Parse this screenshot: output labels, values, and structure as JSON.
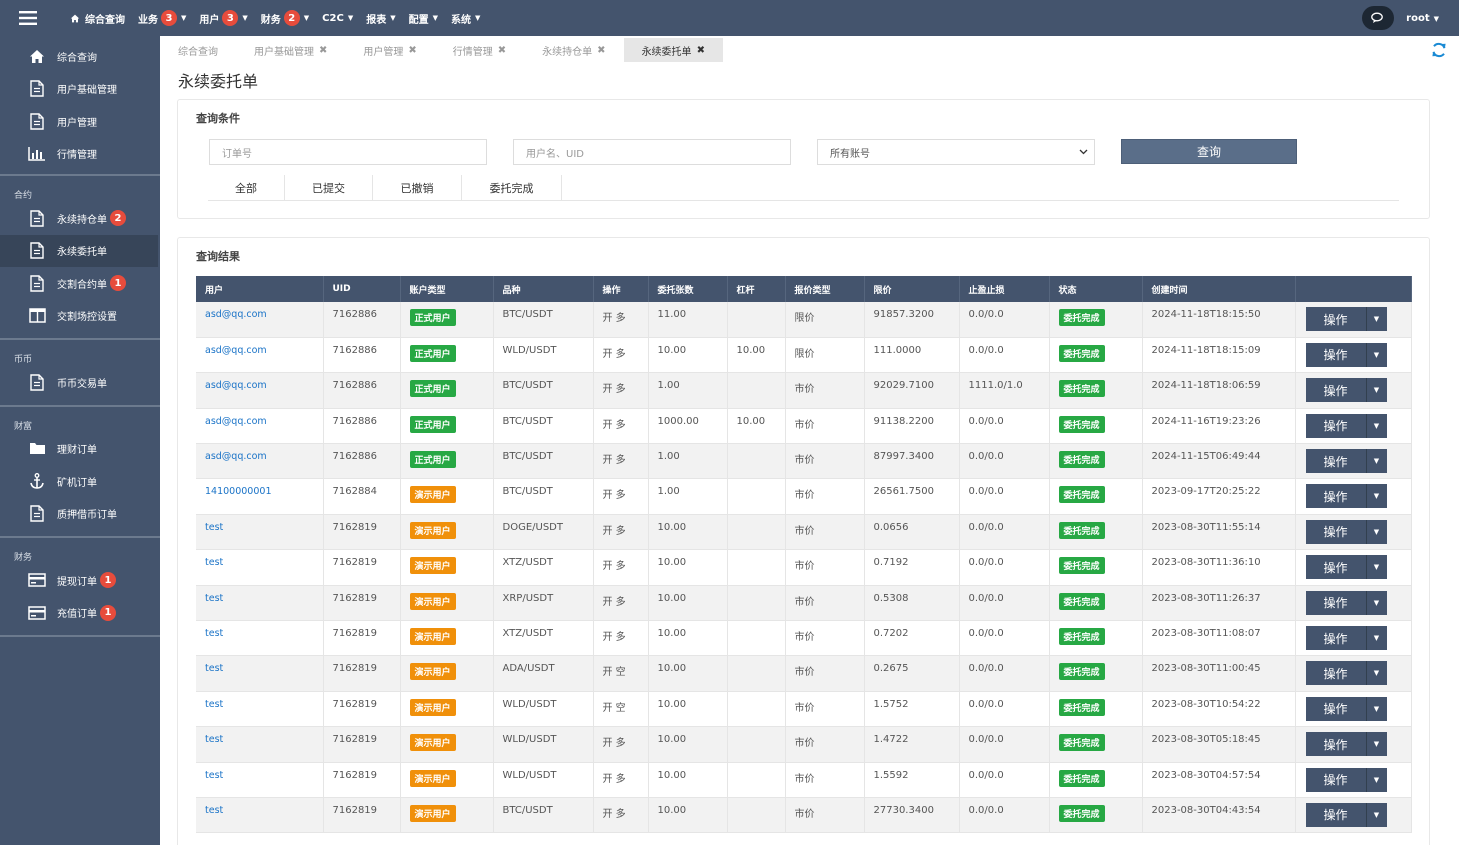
{
  "topbar": {
    "nav": [
      {
        "label": "综合查询",
        "icon": "home-icon",
        "badge": null,
        "caret": false
      },
      {
        "label": "业务",
        "badge": "3",
        "caret": true
      },
      {
        "label": "用户",
        "badge": "3",
        "caret": true
      },
      {
        "label": "财务",
        "badge": "2",
        "caret": true
      },
      {
        "label": "C2C",
        "badge": null,
        "caret": true
      },
      {
        "label": "报表",
        "badge": null,
        "caret": true
      },
      {
        "label": "配置",
        "badge": null,
        "caret": true
      },
      {
        "label": "系统",
        "badge": null,
        "caret": true
      }
    ],
    "user": "root"
  },
  "sidebar": {
    "top_items": [
      {
        "label": "综合查询",
        "icon": "home-icon"
      },
      {
        "label": "用户基础管理",
        "icon": "file-icon"
      },
      {
        "label": "用户管理",
        "icon": "file-icon"
      },
      {
        "label": "行情管理",
        "icon": "bar-chart-icon"
      }
    ],
    "contract": {
      "label": "合约",
      "items": [
        {
          "label": "永续持仓单",
          "icon": "file-icon",
          "badge": "2"
        },
        {
          "label": "永续委托单",
          "icon": "file-icon",
          "badge": null,
          "active": true
        },
        {
          "label": "交割合约单",
          "icon": "file-icon",
          "badge": "1"
        },
        {
          "label": "交割场控设置",
          "icon": "columns-icon",
          "badge": null
        }
      ]
    },
    "coin": {
      "label": "币币",
      "items": [
        {
          "label": "币币交易单",
          "icon": "file-icon",
          "badge": null
        }
      ]
    },
    "wealth": {
      "label": "财富",
      "items": [
        {
          "label": "理财订单",
          "icon": "folder-icon",
          "badge": null
        },
        {
          "label": "矿机订单",
          "icon": "anchor-icon",
          "badge": null
        },
        {
          "label": "质押借币订单",
          "icon": "file-icon",
          "badge": null
        }
      ]
    },
    "finance": {
      "label": "财务",
      "items": [
        {
          "label": "提现订单",
          "icon": "card-icon",
          "badge": "1"
        },
        {
          "label": "充值订单",
          "icon": "card-icon",
          "badge": "1"
        }
      ]
    }
  },
  "tabs": [
    {
      "label": "综合查询",
      "closable": false
    },
    {
      "label": "用户基础管理",
      "closable": true
    },
    {
      "label": "用户管理",
      "closable": true
    },
    {
      "label": "行情管理",
      "closable": true
    },
    {
      "label": "永续持仓单",
      "closable": true
    },
    {
      "label": "永续委托单",
      "closable": true,
      "active": true
    }
  ],
  "page_title": "永续委托单",
  "query": {
    "title": "查询条件",
    "order_placeholder": "订单号",
    "user_placeholder": "用户名、UID",
    "account_select": "所有账号",
    "query_button": "查询",
    "filters": [
      "全部",
      "已提交",
      "已撤销",
      "委托完成"
    ]
  },
  "results": {
    "title": "查询结果",
    "columns": [
      "用户",
      "UID",
      "账户类型",
      "品种",
      "操作",
      "委托张数",
      "杠杆",
      "报价类型",
      "限价",
      "止盈止损",
      "状态",
      "创建时间",
      ""
    ],
    "op_label": "操作",
    "rows": [
      {
        "user": "asd@qq.com",
        "uid": "7162886",
        "type": "正式用户",
        "real": true,
        "symbol": "BTC/USDT",
        "dir": "开 多",
        "qty": "11.00",
        "lev": "",
        "ptype": "限价",
        "price": "91857.3200",
        "tpsl": "0.0/0.0",
        "status": "委托完成",
        "time": "2024-11-18T18:15:50"
      },
      {
        "user": "asd@qq.com",
        "uid": "7162886",
        "type": "正式用户",
        "real": true,
        "symbol": "WLD/USDT",
        "dir": "开 多",
        "qty": "10.00",
        "lev": "10.00",
        "ptype": "限价",
        "price": "111.0000",
        "tpsl": "0.0/0.0",
        "status": "委托完成",
        "time": "2024-11-18T18:15:09"
      },
      {
        "user": "asd@qq.com",
        "uid": "7162886",
        "type": "正式用户",
        "real": true,
        "symbol": "BTC/USDT",
        "dir": "开 多",
        "qty": "1.00",
        "lev": "",
        "ptype": "市价",
        "price": "92029.7100",
        "tpsl": "1111.0/1.0",
        "status": "委托完成",
        "time": "2024-11-18T18:06:59"
      },
      {
        "user": "asd@qq.com",
        "uid": "7162886",
        "type": "正式用户",
        "real": true,
        "symbol": "BTC/USDT",
        "dir": "开 多",
        "qty": "1000.00",
        "lev": "10.00",
        "ptype": "市价",
        "price": "91138.2200",
        "tpsl": "0.0/0.0",
        "status": "委托完成",
        "time": "2024-11-16T19:23:26"
      },
      {
        "user": "asd@qq.com",
        "uid": "7162886",
        "type": "正式用户",
        "real": true,
        "symbol": "BTC/USDT",
        "dir": "开 多",
        "qty": "1.00",
        "lev": "",
        "ptype": "市价",
        "price": "87997.3400",
        "tpsl": "0.0/0.0",
        "status": "委托完成",
        "time": "2024-11-15T06:49:44"
      },
      {
        "user": "14100000001",
        "uid": "7162884",
        "type": "演示用户",
        "real": false,
        "symbol": "BTC/USDT",
        "dir": "开 多",
        "qty": "1.00",
        "lev": "",
        "ptype": "市价",
        "price": "26561.7500",
        "tpsl": "0.0/0.0",
        "status": "委托完成",
        "time": "2023-09-17T20:25:22"
      },
      {
        "user": "test",
        "uid": "7162819",
        "type": "演示用户",
        "real": false,
        "symbol": "DOGE/USDT",
        "dir": "开 多",
        "qty": "10.00",
        "lev": "",
        "ptype": "市价",
        "price": "0.0656",
        "tpsl": "0.0/0.0",
        "status": "委托完成",
        "time": "2023-08-30T11:55:14"
      },
      {
        "user": "test",
        "uid": "7162819",
        "type": "演示用户",
        "real": false,
        "symbol": "XTZ/USDT",
        "dir": "开 多",
        "qty": "10.00",
        "lev": "",
        "ptype": "市价",
        "price": "0.7192",
        "tpsl": "0.0/0.0",
        "status": "委托完成",
        "time": "2023-08-30T11:36:10"
      },
      {
        "user": "test",
        "uid": "7162819",
        "type": "演示用户",
        "real": false,
        "symbol": "XRP/USDT",
        "dir": "开 多",
        "qty": "10.00",
        "lev": "",
        "ptype": "市价",
        "price": "0.5308",
        "tpsl": "0.0/0.0",
        "status": "委托完成",
        "time": "2023-08-30T11:26:37"
      },
      {
        "user": "test",
        "uid": "7162819",
        "type": "演示用户",
        "real": false,
        "symbol": "XTZ/USDT",
        "dir": "开 多",
        "qty": "10.00",
        "lev": "",
        "ptype": "市价",
        "price": "0.7202",
        "tpsl": "0.0/0.0",
        "status": "委托完成",
        "time": "2023-08-30T11:08:07"
      },
      {
        "user": "test",
        "uid": "7162819",
        "type": "演示用户",
        "real": false,
        "symbol": "ADA/USDT",
        "dir": "开 空",
        "qty": "10.00",
        "lev": "",
        "ptype": "市价",
        "price": "0.2675",
        "tpsl": "0.0/0.0",
        "status": "委托完成",
        "time": "2023-08-30T11:00:45"
      },
      {
        "user": "test",
        "uid": "7162819",
        "type": "演示用户",
        "real": false,
        "symbol": "WLD/USDT",
        "dir": "开 空",
        "qty": "10.00",
        "lev": "",
        "ptype": "市价",
        "price": "1.5752",
        "tpsl": "0.0/0.0",
        "status": "委托完成",
        "time": "2023-08-30T10:54:22"
      },
      {
        "user": "test",
        "uid": "7162819",
        "type": "演示用户",
        "real": false,
        "symbol": "WLD/USDT",
        "dir": "开 多",
        "qty": "10.00",
        "lev": "",
        "ptype": "市价",
        "price": "1.4722",
        "tpsl": "0.0/0.0",
        "status": "委托完成",
        "time": "2023-08-30T05:18:45"
      },
      {
        "user": "test",
        "uid": "7162819",
        "type": "演示用户",
        "real": false,
        "symbol": "WLD/USDT",
        "dir": "开 多",
        "qty": "10.00",
        "lev": "",
        "ptype": "市价",
        "price": "1.5592",
        "tpsl": "0.0/0.0",
        "status": "委托完成",
        "time": "2023-08-30T04:57:54"
      },
      {
        "user": "test",
        "uid": "7162819",
        "type": "演示用户",
        "real": false,
        "symbol": "BTC/USDT",
        "dir": "开 多",
        "qty": "10.00",
        "lev": "",
        "ptype": "市价",
        "price": "27730.3400",
        "tpsl": "0.0/0.0",
        "status": "委托完成",
        "time": "2023-08-30T04:43:54"
      }
    ]
  }
}
